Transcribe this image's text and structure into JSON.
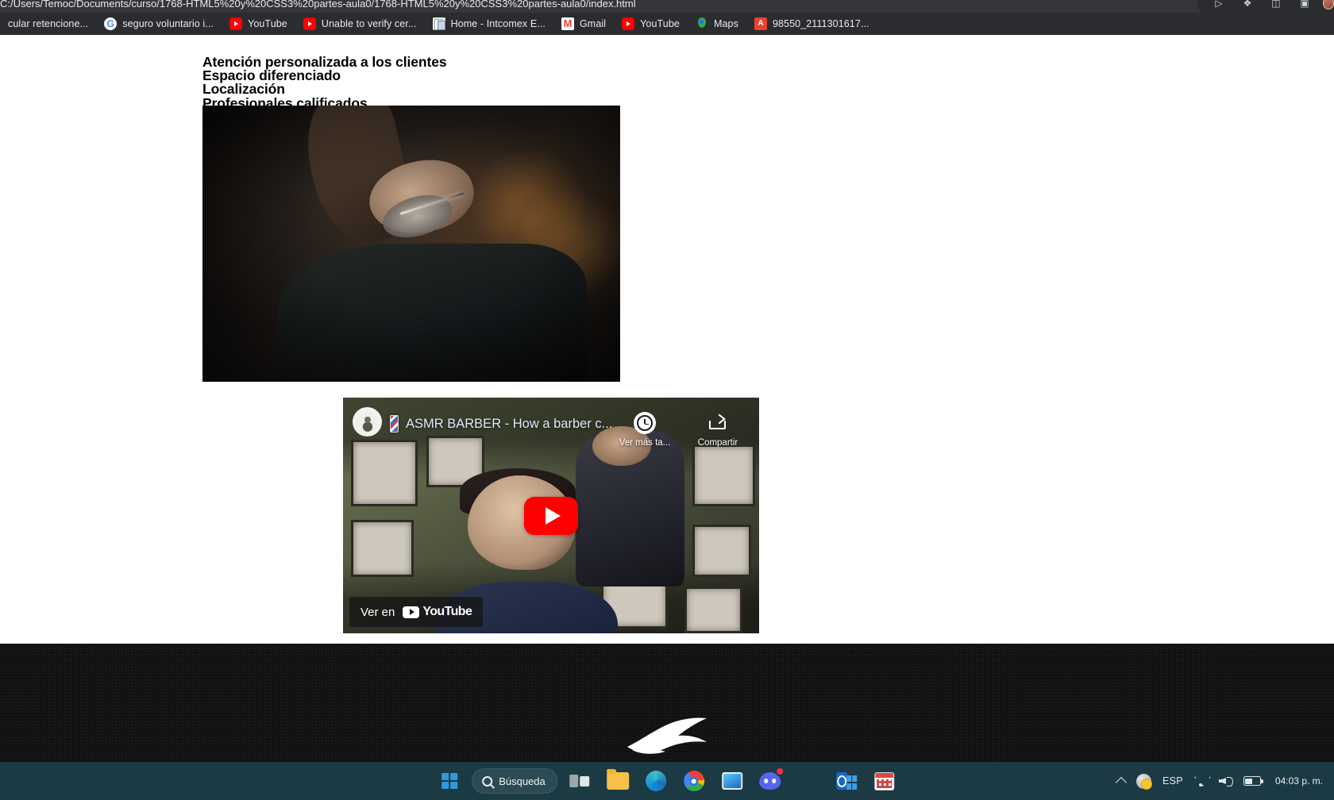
{
  "browser": {
    "url": "C:/Users/Temoc/Documents/curso/1768-HTML5%20y%20CSS3%20partes-aula0/1768-HTML5%20y%20CSS3%20partes-aula0/index.html",
    "toolbar_icons": [
      {
        "name": "share-icon",
        "glyph": "⤴"
      },
      {
        "name": "bookmark-star-icon",
        "glyph": "☆"
      },
      {
        "name": "media-control-icon",
        "glyph": "▷"
      },
      {
        "name": "extensions-puzzle-icon",
        "glyph": "❖"
      },
      {
        "name": "split-screen-icon",
        "glyph": "◫"
      },
      {
        "name": "sidebar-icon",
        "glyph": "▣"
      }
    ],
    "bookmarks": [
      {
        "label": "cular retencione...",
        "icon": "generic-favicon"
      },
      {
        "label": "seguro voluntario i...",
        "icon": "google-favicon"
      },
      {
        "label": "YouTube",
        "icon": "youtube-favicon"
      },
      {
        "label": "Unable to verify cer...",
        "icon": "youtube-favicon"
      },
      {
        "label": "Home - Intcomex E...",
        "icon": "document-favicon"
      },
      {
        "label": "Gmail",
        "icon": "gmail-favicon"
      },
      {
        "label": "YouTube",
        "icon": "youtube-favicon"
      },
      {
        "label": "Maps",
        "icon": "maps-favicon"
      },
      {
        "label": "98550_2111301617...",
        "icon": "pdf-favicon"
      }
    ]
  },
  "page": {
    "headings": [
      "Atención personalizada a los clientes",
      "Espacio diferenciado",
      "Localización",
      "Profesionales calificados"
    ],
    "photo_alt": "barbero afeitando a un cliente con navaja",
    "video": {
      "title": "ASMR BARBER - How a barber c...",
      "channel_avatar": "barber-channel-avatar",
      "watch_later_label": "Ver más ta...",
      "share_label": "Compartir",
      "watch_on_prefix": "Ver en",
      "watch_on_brand": "YouTube",
      "play_button": "play-button"
    }
  },
  "taskbar": {
    "start_label": "start-button",
    "search_placeholder": "Búsqueda",
    "items": [
      {
        "name": "task-view-button",
        "icon": "task-view-icon"
      },
      {
        "name": "file-explorer-button",
        "icon": "folder-icon"
      },
      {
        "name": "edge-button",
        "icon": "edge-icon"
      },
      {
        "name": "chrome-button",
        "icon": "chrome-icon"
      },
      {
        "name": "remote-desktop-button",
        "icon": "remote-desktop-icon"
      },
      {
        "name": "discord-button",
        "icon": "discord-icon"
      },
      {
        "name": "vscode-button",
        "icon": "vscode-icon"
      },
      {
        "name": "outlook-button",
        "icon": "outlook-icon"
      },
      {
        "name": "calendar-button",
        "icon": "calendar-icon"
      }
    ],
    "tray": {
      "language": "ESP",
      "time": "04:03 p. m.",
      "date": ""
    }
  },
  "colors": {
    "chrome_bg": "#35363a",
    "bookmarks_bg": "#2b2c2f",
    "page_bg": "#ffffff",
    "footer_bg": "#111111",
    "taskbar_bg": "#1b3a44",
    "youtube_red": "#ff0000",
    "video_title": "#ddecff"
  }
}
